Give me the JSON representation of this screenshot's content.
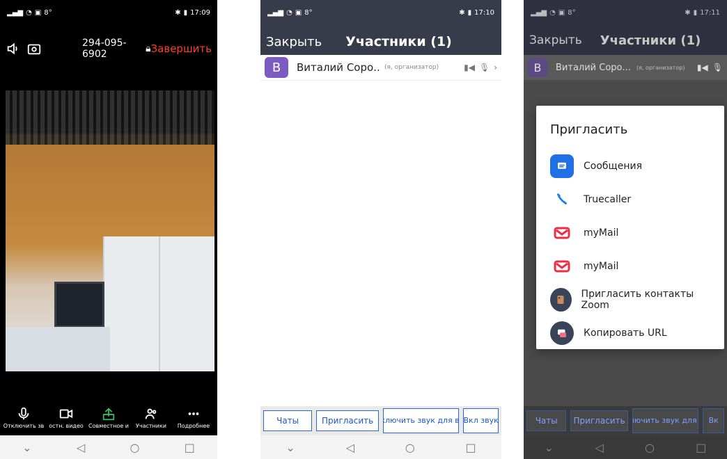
{
  "phone1": {
    "status": {
      "left": "8°",
      "right": "17:09"
    },
    "meeting_id": "294-095-6902",
    "end_label": "Завершить",
    "toolbar": [
      {
        "label": "Отключить зв",
        "icon": "mic-icon"
      },
      {
        "label": "остн. видео",
        "icon": "video-icon"
      },
      {
        "label": "Совместное и",
        "icon": "share-icon"
      },
      {
        "label": "Участники",
        "icon": "participants-icon"
      },
      {
        "label": "Подробнее",
        "icon": "more-icon"
      }
    ]
  },
  "phone2": {
    "status": {
      "left": "8°",
      "right": "17:10"
    },
    "close_label": "Закрыть",
    "title": "Участники (1)",
    "participant": {
      "initial": "В",
      "name": "Виталий Соро...",
      "role": "(я, организатор)"
    },
    "buttons": [
      "Чаты",
      "Пригласить",
      "Выключить звук для всех",
      "Вкл звук"
    ]
  },
  "phone3": {
    "status": {
      "left": "8°",
      "right": "17:11"
    },
    "close_label": "Закрыть",
    "title": "Участники (1)",
    "participant": {
      "initial": "В",
      "name": "Виталий Соро...",
      "role": "(я, организатор)"
    },
    "dialog": {
      "title": "Пригласить",
      "options": [
        {
          "label": "Сообщения",
          "icon": "messages-icon",
          "color": "#1f6fe5"
        },
        {
          "label": "Truecaller",
          "icon": "phone-icon",
          "color": "#1a7fe5"
        },
        {
          "label": "myMail",
          "icon": "mail-icon",
          "color": "#ea2f44"
        },
        {
          "label": "myMail",
          "icon": "mail-icon",
          "color": "#ea2f44"
        },
        {
          "label": "Пригласить контакты Zoom",
          "icon": "contacts-icon",
          "color": "#3a4458"
        },
        {
          "label": "Копировать URL",
          "icon": "copy-url-icon",
          "color": "#3a4458"
        }
      ]
    },
    "buttons": [
      "Чаты",
      "Пригласить",
      "Выключить звук для всех",
      "Вк"
    ]
  }
}
